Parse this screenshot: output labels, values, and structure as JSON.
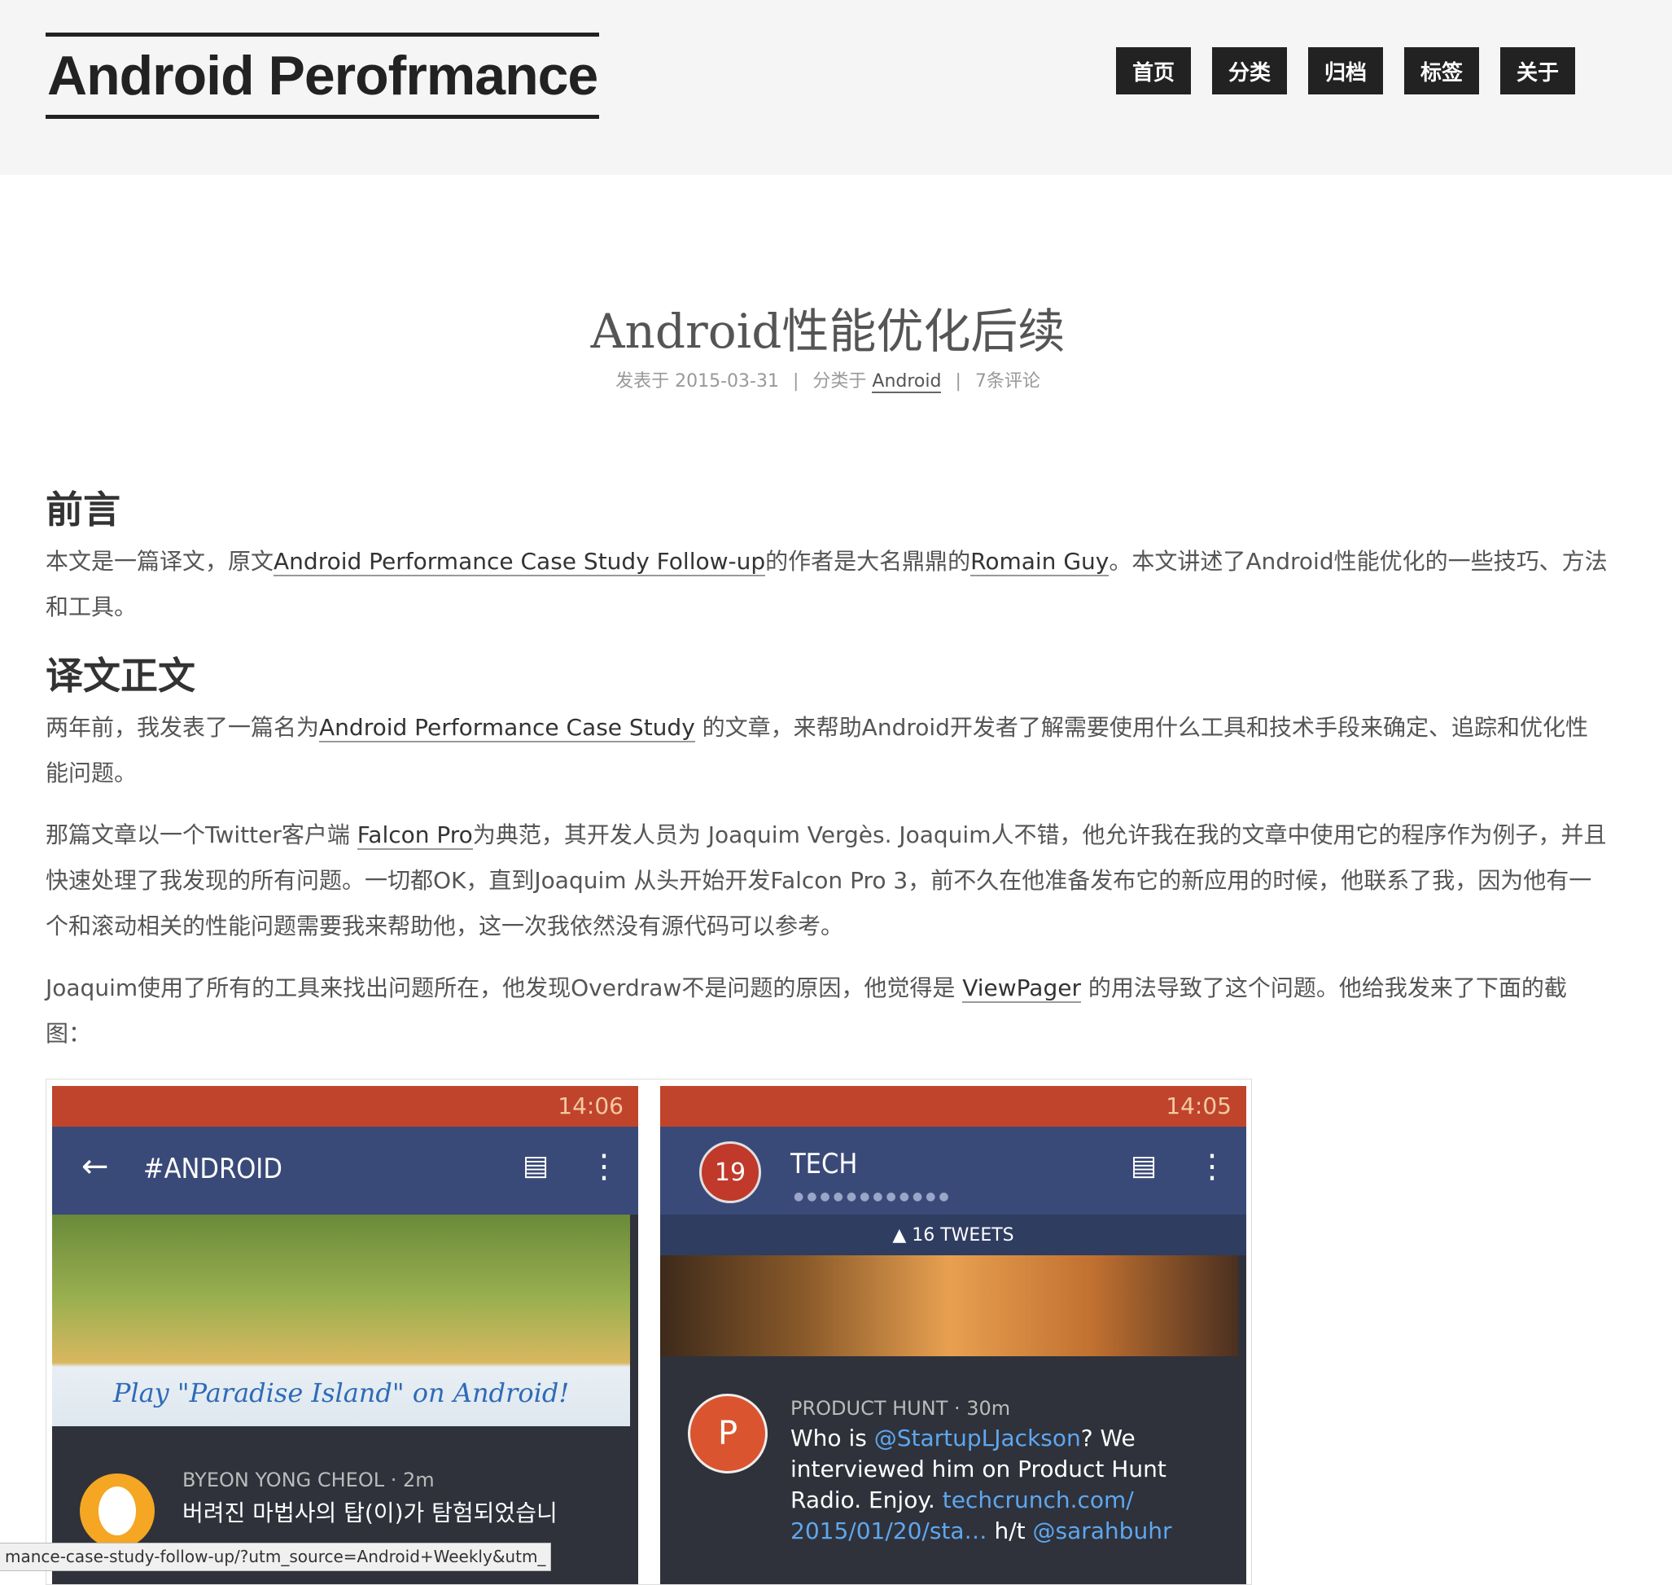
{
  "site": {
    "title": "Android Perofrmance",
    "menu": [
      "首页",
      "分类",
      "归档",
      "标签",
      "关于"
    ]
  },
  "post": {
    "title": "Android性能优化后续",
    "meta": {
      "published_prefix": "发表于",
      "date": "2015-03-31",
      "category_prefix": "分类于",
      "category": "Android",
      "comments": "7条评论",
      "separator": "|"
    }
  },
  "article": {
    "section1_heading": "前言",
    "p1": {
      "t1": "本文是一篇译文，原文",
      "link1": "Android Performance Case Study Follow-up",
      "t2": "的作者是大名鼎鼎的",
      "link2": "Romain Guy",
      "t3": "。本文讲述了Android性能优化的一些技巧、方法和工具。"
    },
    "section2_heading": "译文正文",
    "p2": {
      "t1": "两年前，我发表了一篇名为",
      "link1": "Android Performance Case Study",
      "t2": " 的文章，来帮助Android开发者了解需要使用什么工具和技术手段来确定、追踪和优化性能问题。"
    },
    "p3": {
      "t1": "那篇文章以一个Twitter客户端 ",
      "link1": "Falcon Pro",
      "t2": "为典范，其开发人员为 Joaquim Vergès. Joaquim人不错，他允许我在我的文章中使用它的程序作为例子，并且快速处理了我发现的所有问题。一切都OK，直到Joaquim 从头开始开发Falcon Pro 3，前不久在他准备发布它的新应用的时候，他联系了我，因为他有一个和滚动相关的性能问题需要我来帮助他，这一次我依然没有源代码可以参考。"
    },
    "p4": {
      "t1": "Joaquim使用了所有的工具来找出问题所在，他发现Overdraw不是问题的原因，他觉得是 ",
      "link1": "ViewPager",
      "t2": " 的用法导致了这个问题。他给我发来了下面的截图："
    }
  },
  "screenshots": {
    "left": {
      "time": "14:06",
      "title": "#ANDROID",
      "game_caption": "Play \"Paradise Island\" on Android!",
      "tweet_user": "BYEON YONG CHEOL · 2m",
      "tweet_text": "버려진 마법사의 탑(이)가 탐험되었습니"
    },
    "right": {
      "time": "14:05",
      "count": "19",
      "title": "TECH",
      "tweets_bar": "▲ 16 TWEETS",
      "avatar_letter": "P",
      "tweet_user": "PRODUCT HUNT · 30m",
      "tweet_t1": "Who is ",
      "tweet_l1": "@StartupLJackson",
      "tweet_t2": "? We interviewed him on Product Hunt Radio. Enjoy. ",
      "tweet_l2": "techcrunch.com/ 2015/01/20/sta…",
      "tweet_t3": " h/t ",
      "tweet_l3": "@sarahbuhr"
    }
  },
  "status_url": "mance-case-study-follow-up/?utm_source=Android+Weekly&utm_",
  "colors": {
    "header_bg": "#f5f5f5",
    "menu_bg": "#222222",
    "appbar": "#3a4a78",
    "link_blue": "#5ea7ef"
  }
}
